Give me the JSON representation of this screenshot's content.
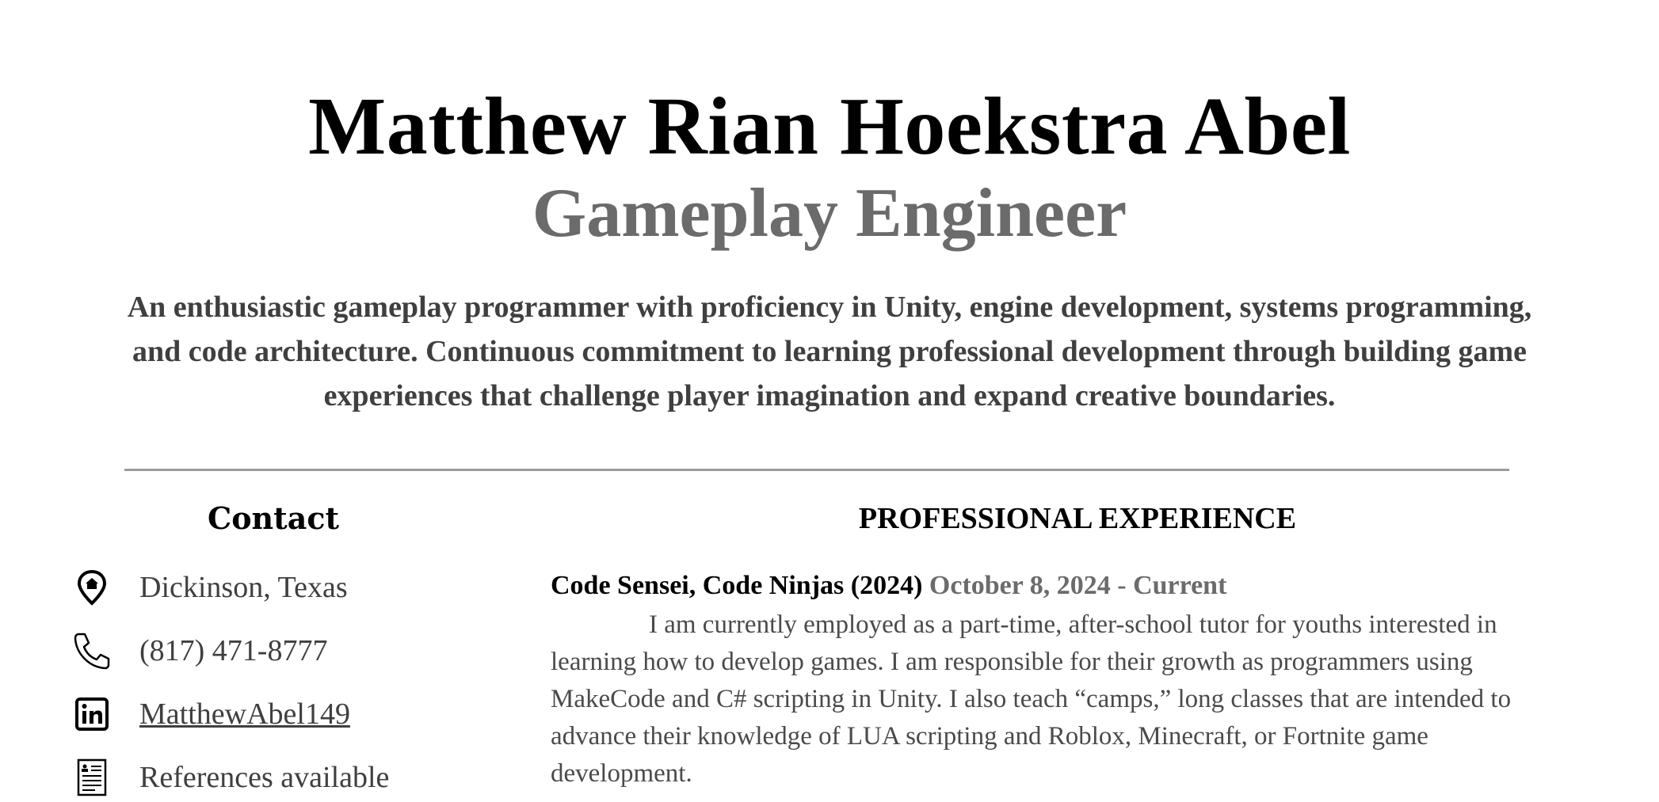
{
  "header": {
    "name": "Matthew Rian Hoekstra Abel",
    "title": "Gameplay Engineer"
  },
  "summary": "An enthusiastic gameplay programmer with proficiency in Unity, engine development, systems programming, and code architecture. Continuous commitment to learning professional development through building game experiences that challenge player imagination and expand creative boundaries.",
  "contact": {
    "title": "Contact",
    "items": [
      {
        "icon": "location-pin-icon",
        "text": "Dickinson, Texas"
      },
      {
        "icon": "phone-icon",
        "text": "(817) 471-8777"
      },
      {
        "icon": "linkedin-icon",
        "text": "MatthewAbel149"
      },
      {
        "icon": "document-icon",
        "text": "References available"
      }
    ]
  },
  "experience": {
    "title": "PROFESSIONAL EXPERIENCE",
    "jobs": [
      {
        "role": "Code Sensei, Code Ninjas (2024)",
        "dates": "October 8, 2024 - Current",
        "description": "I am currently employed as a part-time, after-school tutor for youths interested in learning how to develop games. I am responsible for their growth as programmers using MakeCode and C# scripting in Unity. I also teach “camps,” long classes that are intended to advance their knowledge of LUA scripting and Roblox, Minecraft, or Fortnite game development."
      }
    ]
  }
}
